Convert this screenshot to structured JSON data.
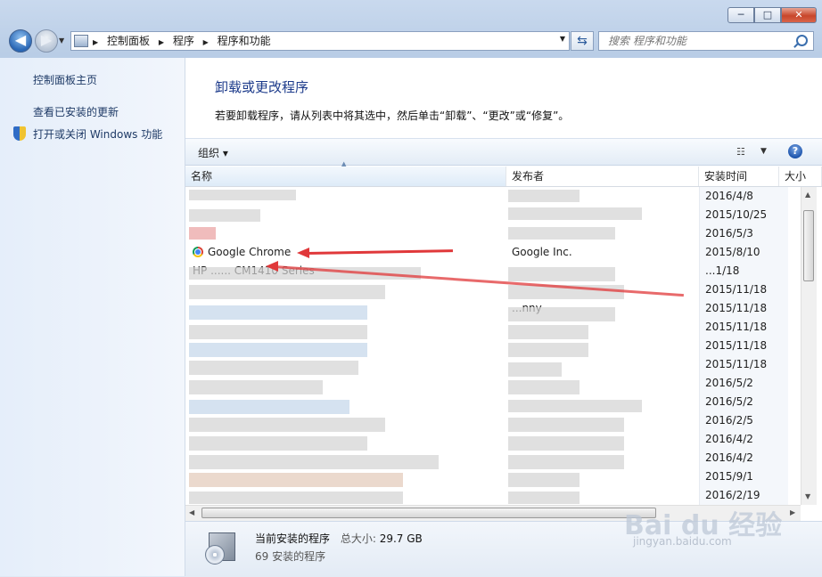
{
  "window": {
    "min_label": "─",
    "max_label": "□",
    "close_label": "✕"
  },
  "nav": {
    "back_label": "◀",
    "forward_label": "▶",
    "breadcrumbs": [
      "控制面板",
      "程序",
      "程序和功能"
    ],
    "search_placeholder": "搜索 程序和功能"
  },
  "sidebar": {
    "items": [
      {
        "label": "控制面板主页"
      },
      {
        "label": "查看已安装的更新"
      },
      {
        "label": "打开或关闭 Windows 功能"
      }
    ]
  },
  "main": {
    "heading": "卸载或更改程序",
    "description": "若要卸载程序，请从列表中将其选中，然后单击“卸载”、“更改”或“修复”。"
  },
  "toolbar": {
    "organize_label": "组织 ▾",
    "help_label": "?"
  },
  "table": {
    "columns": [
      "名称",
      "发布者",
      "安装时间",
      "大小"
    ],
    "rows": [
      {
        "name": "",
        "publisher": "",
        "date": "2016/4/8"
      },
      {
        "name": "",
        "publisher": "",
        "date": "2015/10/25"
      },
      {
        "name": "",
        "publisher": "",
        "date": "2016/5/3"
      },
      {
        "name": "Google Chrome",
        "publisher": "Google Inc.",
        "date": "2015/8/10"
      },
      {
        "name": "HP ...... CM1410 Series",
        "publisher": "",
        "date": "...1/18"
      },
      {
        "name": "",
        "publisher": "",
        "date": "2015/11/18"
      },
      {
        "name": "",
        "publisher": "...nny",
        "date": "2015/11/18"
      },
      {
        "name": "",
        "publisher": "",
        "date": "2015/11/18"
      },
      {
        "name": "",
        "publisher": "",
        "date": "2015/11/18"
      },
      {
        "name": "",
        "publisher": "",
        "date": "2015/11/18"
      },
      {
        "name": "",
        "publisher": "",
        "date": "2016/5/2"
      },
      {
        "name": "",
        "publisher": "",
        "date": "2016/5/2"
      },
      {
        "name": "",
        "publisher": "",
        "date": "2016/2/5"
      },
      {
        "name": "",
        "publisher": "",
        "date": "2016/4/2"
      },
      {
        "name": "",
        "publisher": "",
        "date": "2016/4/2"
      },
      {
        "name": "",
        "publisher": "",
        "date": "2015/9/1"
      },
      {
        "name": "",
        "publisher": "",
        "date": "2016/2/19"
      }
    ]
  },
  "status": {
    "title": "当前安装的程序",
    "size_label": "总大小:",
    "size_value": "29.7 GB",
    "count": "69 安装的程序"
  },
  "watermark": {
    "logo": "Bai du 经验",
    "url": "jingyan.baidu.com"
  }
}
